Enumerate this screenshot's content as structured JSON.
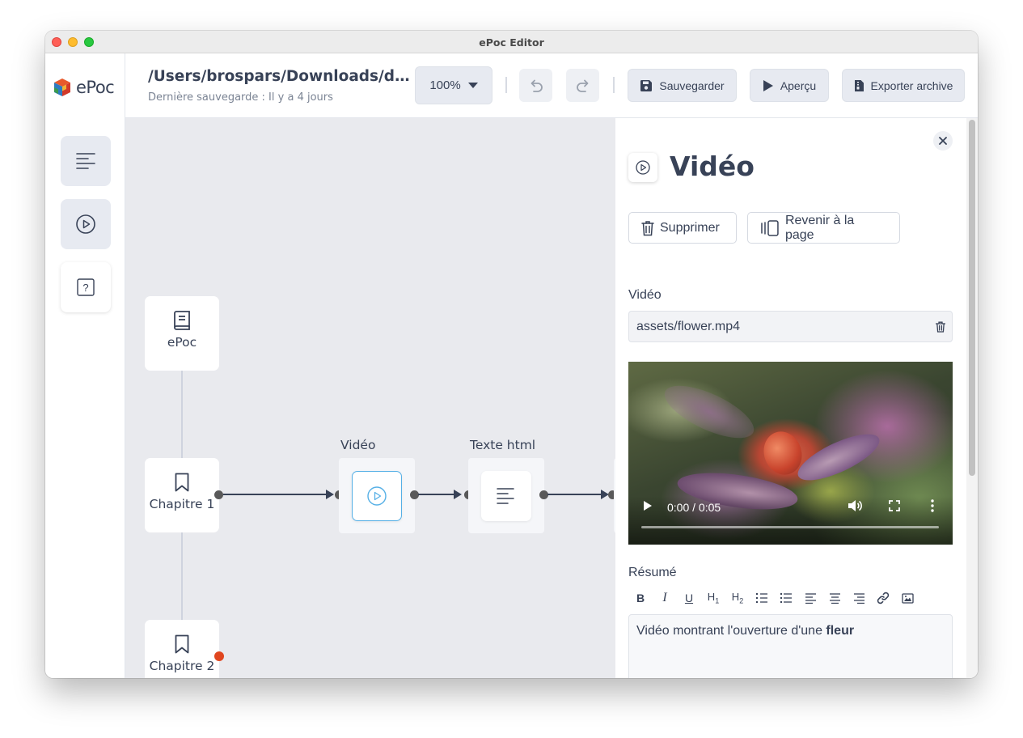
{
  "window": {
    "title": "ePoc Editor"
  },
  "nav": {
    "logo_text": "ePoc",
    "items": [
      {
        "icon": "align-left-icon"
      },
      {
        "icon": "play-circle-icon"
      },
      {
        "icon": "help-icon",
        "glyph": "?"
      }
    ]
  },
  "header": {
    "path": "/Users/brospars/Downloads/dem…",
    "last_saved": "Dernière sauvegarde : Il y a 4 jours",
    "zoom": "100%",
    "save_label": "Sauvegarder",
    "preview_label": "Aperçu",
    "export_label": "Exporter archive"
  },
  "canvas": {
    "root_node": {
      "label": "ePoc",
      "icon": "book-icon"
    },
    "chapters": [
      {
        "label": "Chapitre 1",
        "icon": "bookmark-icon"
      },
      {
        "label": "Chapitre 2",
        "icon": "bookmark-icon",
        "has_alert": true
      }
    ],
    "pages": [
      {
        "title": "Vidéo",
        "icon": "play-circle-icon",
        "selected": true
      },
      {
        "title": "Texte html",
        "icon": "align-left-icon",
        "selected": false
      }
    ]
  },
  "panel": {
    "title": "Vidéo",
    "delete_label": "Supprimer",
    "back_label": "Revenir à la page",
    "video_label": "Vidéo",
    "video_value": "assets/flower.mp4",
    "player_time": "0:00 / 0:05",
    "summary_label": "Résumé",
    "format_buttons": [
      "B",
      "I",
      "U",
      "H1",
      "H2",
      "ordered-list",
      "bullet-list",
      "align-left",
      "align-center",
      "align-right",
      "link",
      "image"
    ],
    "summary_text": "Vidéo montrant l'ouverture d'une ",
    "summary_bold": "fleur"
  },
  "colors": {
    "accent_selected": "#56b0e6",
    "alert": "#e0461f",
    "text": "#384257"
  }
}
